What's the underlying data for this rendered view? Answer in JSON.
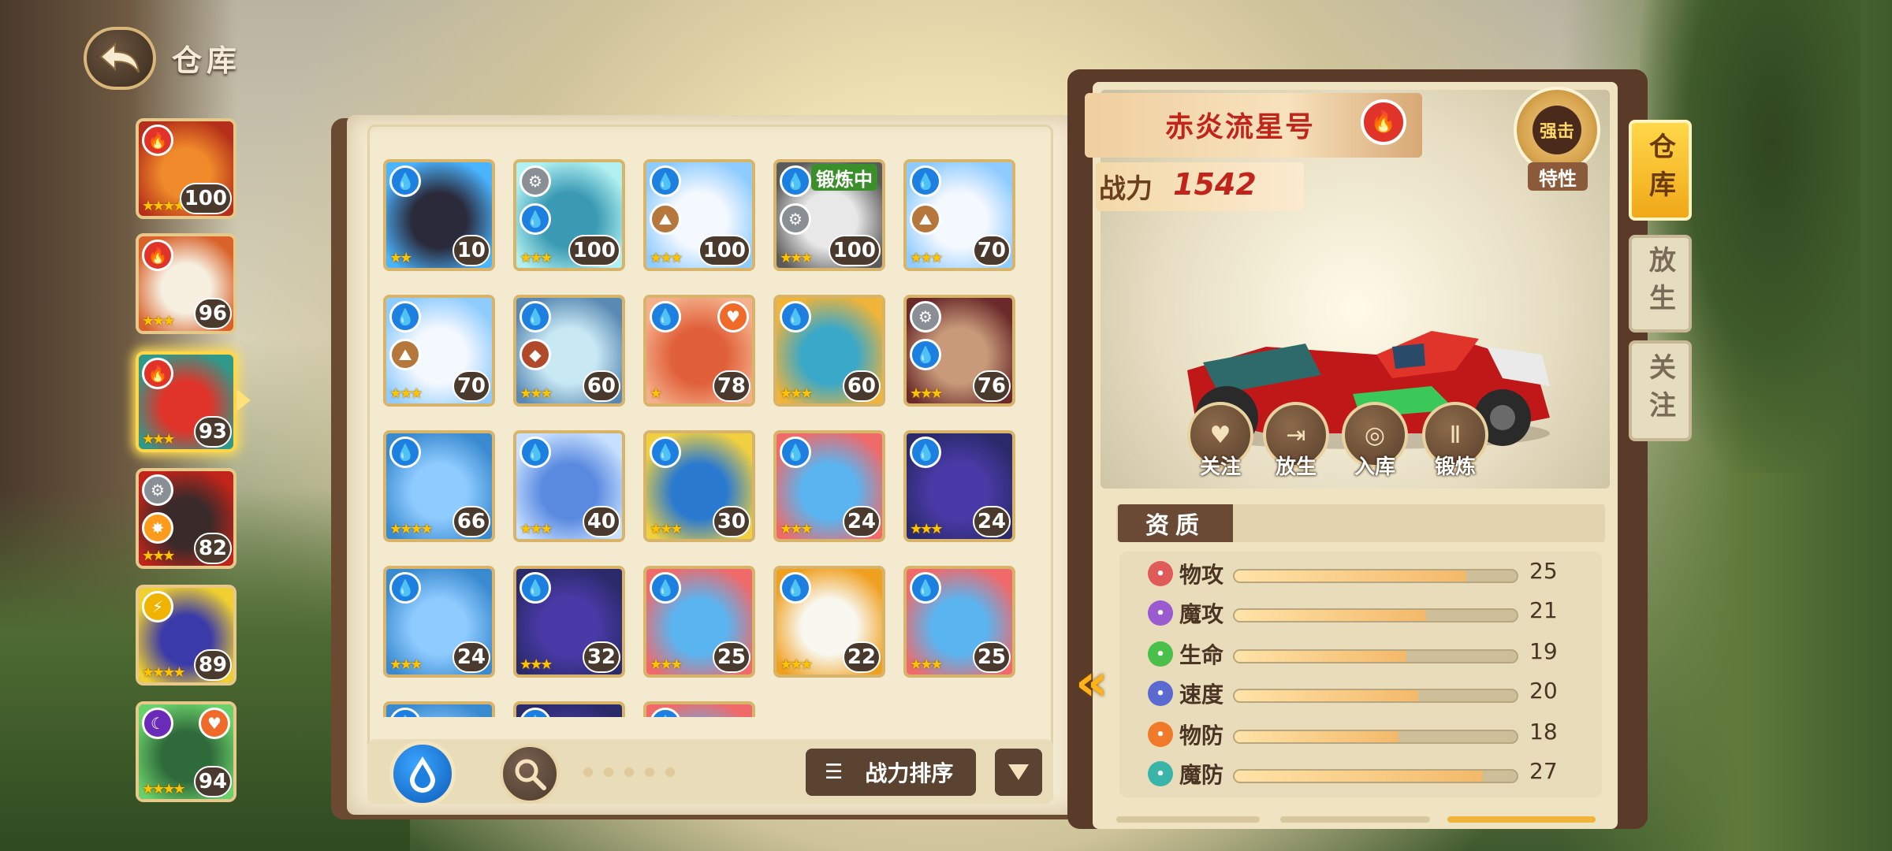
{
  "header": {
    "title": "仓库",
    "back_icon": "back-arrow-icon"
  },
  "team": [
    {
      "element": "fire",
      "level": "100",
      "stars": 4,
      "art": [
        "#f08a2a",
        "#b5301a"
      ]
    },
    {
      "element": "fire",
      "level": "96",
      "stars": 3,
      "art": [
        "#f7efe0",
        "#d8622a"
      ]
    },
    {
      "element": "fire",
      "level": "93",
      "stars": 3,
      "art": [
        "#e0342a",
        "#2f9a8a"
      ],
      "selected": true
    },
    {
      "element": "steel",
      "element2": "light",
      "level": "82",
      "stars": 3,
      "art": [
        "#3a2a2a",
        "#c0241a"
      ]
    },
    {
      "element": "electric",
      "level": "89",
      "stars": 4,
      "art": [
        "#3a3aa8",
        "#f0d030"
      ]
    },
    {
      "element": "shadow",
      "element2": "heart",
      "level": "94",
      "stars": 4,
      "art": [
        "#2f6a3a",
        "#6ad06a"
      ]
    }
  ],
  "storage": [
    {
      "element": "water",
      "level": "10",
      "stars": 2,
      "art": [
        "#2a2a3a",
        "#4ab4ff"
      ]
    },
    {
      "element": "steel",
      "element2": "water",
      "level": "100",
      "stars": 3,
      "art": [
        "#3a9ab4",
        "#b0f0f0"
      ]
    },
    {
      "element": "water",
      "element2": "earth",
      "level": "100",
      "stars": 3,
      "art": [
        "#f4f8ff",
        "#8ecbff"
      ]
    },
    {
      "element": "water",
      "element2": "steel",
      "level": "100",
      "stars": 3,
      "art": [
        "#e8e8e8",
        "#5a5a5a"
      ],
      "status": "锻炼中"
    },
    {
      "element": "water",
      "element2": "earth",
      "level": "70",
      "stars": 3,
      "art": [
        "#f4f8ff",
        "#8ecbff"
      ]
    },
    {
      "element": "water",
      "element2": "earth",
      "level": "70",
      "stars": 3,
      "art": [
        "#f4f8ff",
        "#8ecbff"
      ]
    },
    {
      "element": "water",
      "element2": "rock",
      "level": "60",
      "stars": 3,
      "art": [
        "#c8e8f4",
        "#5a8ab4"
      ]
    },
    {
      "element": "water",
      "element2": "heart",
      "level": "78",
      "stars": 1,
      "art": [
        "#e0603a",
        "#f4b08a"
      ]
    },
    {
      "element": "water",
      "level": "60",
      "stars": 3,
      "art": [
        "#3aa8c8",
        "#f0b43a"
      ]
    },
    {
      "element": "steel",
      "element2": "water",
      "level": "76",
      "stars": 3,
      "art": [
        "#c89a7a",
        "#6a2a2a"
      ]
    },
    {
      "element": "water",
      "level": "66",
      "stars": 4,
      "art": [
        "#8ecbff",
        "#3a8ad0"
      ]
    },
    {
      "element": "water",
      "level": "40",
      "stars": 3,
      "art": [
        "#5a8ae0",
        "#c8e0ff"
      ]
    },
    {
      "element": "water",
      "level": "30",
      "stars": 3,
      "art": [
        "#2a7ad0",
        "#f0d040"
      ]
    },
    {
      "element": "water",
      "level": "24",
      "stars": 3,
      "art": [
        "#5ab4f0",
        "#f06a6a"
      ]
    },
    {
      "element": "water",
      "level": "24",
      "stars": 3,
      "art": [
        "#4a3aa8",
        "#2a2a6a"
      ]
    },
    {
      "element": "water",
      "level": "24",
      "stars": 3,
      "art": [
        "#8ecbff",
        "#3a8ad0"
      ]
    },
    {
      "element": "water",
      "level": "32",
      "stars": 3,
      "art": [
        "#4a3aa8",
        "#2a2a6a"
      ]
    },
    {
      "element": "water",
      "level": "25",
      "stars": 3,
      "art": [
        "#5ab4f0",
        "#f06a6a"
      ]
    },
    {
      "element": "water",
      "level": "22",
      "stars": 3,
      "art": [
        "#f8f8f0",
        "#f0a020"
      ]
    },
    {
      "element": "water",
      "level": "25",
      "stars": 3,
      "art": [
        "#5ab4f0",
        "#f06a6a"
      ]
    },
    {
      "element": "water",
      "level": "",
      "stars": 0,
      "art": [
        "#8ecbff",
        "#3a8ad0"
      ]
    },
    {
      "element": "water",
      "level": "",
      "stars": 0,
      "art": [
        "#4a3aa8",
        "#2a2a6a"
      ]
    },
    {
      "element": "water",
      "level": "",
      "stars": 0,
      "art": [
        "#5ab4f0",
        "#f06a6a"
      ]
    }
  ],
  "toolbar": {
    "filter_icon": "water-drop-icon",
    "search_icon": "search-icon",
    "sort_label": "战力排序",
    "dropdown_icon": "triangle-down-icon"
  },
  "detail": {
    "name": "赤炎流星号",
    "element": "fire",
    "power_label": "战力",
    "power_value": "1542",
    "trait_badge": "强击",
    "trait_label": "特性",
    "actions": [
      {
        "label": "关注",
        "icon": "favorite-icon"
      },
      {
        "label": "放生",
        "icon": "release-door-icon"
      },
      {
        "label": "入库",
        "icon": "storage-ball-icon"
      },
      {
        "label": "锻炼",
        "icon": "dumbbell-icon"
      }
    ],
    "aptitude_title": "资质",
    "stats": [
      {
        "name": "物攻",
        "value": "25",
        "fill": 0.82,
        "color": "#e05a5a",
        "icon": "sword-icon"
      },
      {
        "name": "魔攻",
        "value": "21",
        "fill": 0.68,
        "color": "#9a5ad0",
        "icon": "magic-icon"
      },
      {
        "name": "生命",
        "value": "19",
        "fill": 0.61,
        "color": "#4ac04a",
        "icon": "heart-icon"
      },
      {
        "name": "速度",
        "value": "20",
        "fill": 0.65,
        "color": "#5a6ad0",
        "icon": "speed-icon"
      },
      {
        "name": "物防",
        "value": "18",
        "fill": 0.58,
        "color": "#f07a2a",
        "icon": "shield-icon"
      },
      {
        "name": "魔防",
        "value": "27",
        "fill": 0.88,
        "color": "#3ab4a8",
        "icon": "magic-shield-icon"
      }
    ]
  },
  "side_tabs": [
    {
      "label": "仓库",
      "active": true
    },
    {
      "label": "放生",
      "active": false
    },
    {
      "label": "关注",
      "active": false
    }
  ]
}
